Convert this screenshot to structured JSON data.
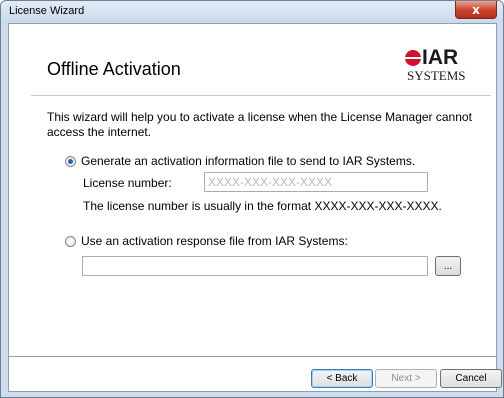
{
  "window": {
    "title": "License Wizard",
    "close_glyph": "x"
  },
  "header": {
    "title": "Offline Activation",
    "logo": {
      "brand_text": "IAR",
      "brand_sub": "SYSTEMS",
      "brand_color": "#d4112b"
    }
  },
  "intro": {
    "text": "This wizard will help you to activate a license when the License Manager cannot access the internet."
  },
  "option_generate": {
    "label": "Generate an activation information file to send to IAR Systems.",
    "checked": true,
    "license_label": "License number:",
    "license_value": "",
    "license_placeholder": "XXXX-XXX-XXX-XXXX",
    "hint": "The license number is usually in the format XXXX-XXX-XXX-XXXX."
  },
  "option_response": {
    "label": "Use an activation response file from IAR Systems:",
    "checked": false,
    "file_value": "",
    "browse_label": "..."
  },
  "footer": {
    "back_label": "< Back",
    "next_label": "Next >",
    "cancel_label": "Cancel"
  }
}
